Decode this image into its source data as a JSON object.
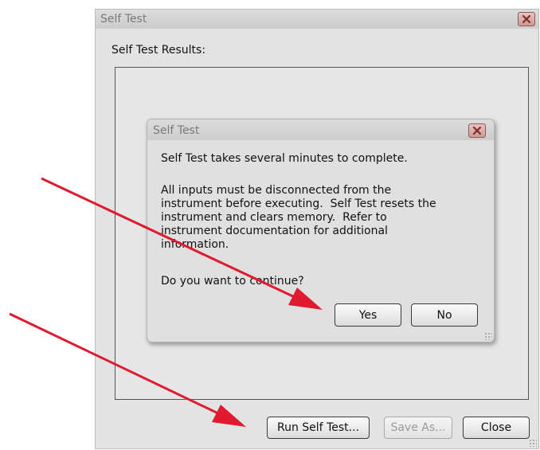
{
  "main_window": {
    "title": "Self Test",
    "results_label": "Self Test Results:",
    "buttons": {
      "run": "Run Self Test...",
      "save_as": "Save As...",
      "close": "Close"
    }
  },
  "dialog": {
    "title": "Self Test",
    "line1": "Self Test takes several minutes to complete.",
    "paragraph": "All inputs must be disconnected from the\ninstrument before executing.  Self Test resets the\ninstrument and clears memory.  Refer to\ninstrument documentation for additional\ninformation.",
    "question": "Do you want to continue?",
    "buttons": {
      "yes": "Yes",
      "no": "No"
    }
  },
  "icons": {
    "close": "close-x-icon",
    "resize": "resize-grip-icon",
    "annotation": "red-arrow"
  },
  "colors": {
    "arrow": "#e01b2f",
    "close_button": "#d9a9a4"
  }
}
